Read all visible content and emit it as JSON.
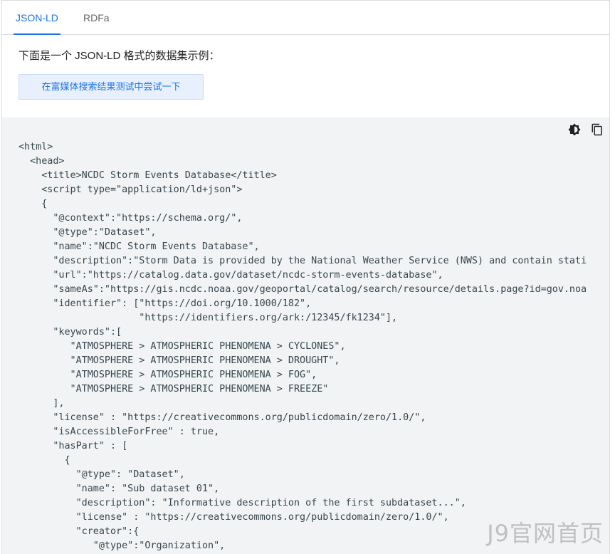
{
  "tabs": [
    {
      "label": "JSON-LD",
      "active": true
    },
    {
      "label": "RDFa",
      "active": false
    }
  ],
  "intro_text": "下面是一个 JSON-LD 格式的数据集示例：",
  "try_button_label": "在富媒体搜索结果测试中尝试一下",
  "toolbar": {
    "theme_icon": "brightness-icon",
    "copy_icon": "copy-icon"
  },
  "code_lines": [
    "<html>",
    "  <head>",
    "    <title>NCDC Storm Events Database</title>",
    "    <script type=\"application/ld+json\">",
    "    {",
    "      \"@context\":\"https://schema.org/\",",
    "      \"@type\":\"Dataset\",",
    "      \"name\":\"NCDC Storm Events Database\",",
    "      \"description\":\"Storm Data is provided by the National Weather Service (NWS) and contain stati",
    "      \"url\":\"https://catalog.data.gov/dataset/ncdc-storm-events-database\",",
    "      \"sameAs\":\"https://gis.ncdc.noaa.gov/geoportal/catalog/search/resource/details.page?id=gov.noa",
    "      \"identifier\": [\"https://doi.org/10.1000/182\",",
    "                     \"https://identifiers.org/ark:/12345/fk1234\"],",
    "      \"keywords\":[",
    "         \"ATMOSPHERE > ATMOSPHERIC PHENOMENA > CYCLONES\",",
    "         \"ATMOSPHERE > ATMOSPHERIC PHENOMENA > DROUGHT\",",
    "         \"ATMOSPHERE > ATMOSPHERIC PHENOMENA > FOG\",",
    "         \"ATMOSPHERE > ATMOSPHERIC PHENOMENA > FREEZE\"",
    "      ],",
    "      \"license\" : \"https://creativecommons.org/publicdomain/zero/1.0/\",",
    "      \"isAccessibleForFree\" : true,",
    "      \"hasPart\" : [",
    "        {",
    "          \"@type\": \"Dataset\",",
    "          \"name\": \"Sub dataset 01\",",
    "          \"description\": \"Informative description of the first subdataset...\",",
    "          \"license\" : \"https://creativecommons.org/publicdomain/zero/1.0/\",",
    "          \"creator\":{",
    "             \"@type\":\"Organization\","
  ],
  "watermark": "J9官网首页"
}
